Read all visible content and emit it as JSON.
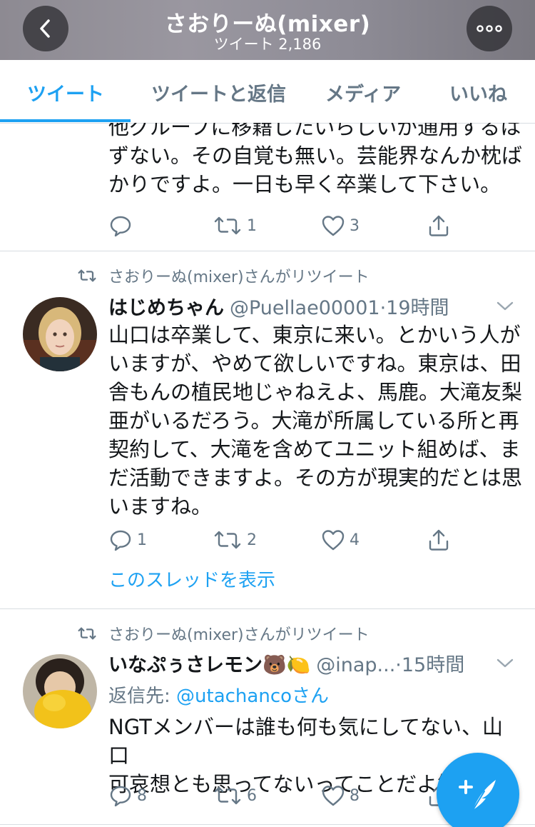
{
  "header": {
    "title": "さおりーぬ(mixer)",
    "subtitle": "ツイート 2,186",
    "back_icon": "chevron-left-icon",
    "more_icon": "more-dots-icon"
  },
  "tabs": [
    {
      "label": "ツイート",
      "active": true
    },
    {
      "label": "ツイートと返信",
      "active": false
    },
    {
      "label": "メディア",
      "active": false
    },
    {
      "label": "いいね",
      "active": false
    }
  ],
  "tweets": [
    {
      "text_lines": [
        "他グループに移籍したいらしいが通用するは",
        "ずない。その自覚も無い。芸能界なんか枕ば",
        "かりですよ。一日も早く卒業して下さい。"
      ],
      "reply_count": "",
      "retweet_count": "1",
      "like_count": "3"
    },
    {
      "retweet_label": "さおりーぬ(mixer)さんがリツイート",
      "name": "はじめちゃん",
      "handle": "@Puellae00001·19時間",
      "text_lines": [
        "山口は卒業して、東京に来い。とかいう人が",
        "いますが、やめて欲しいですね。東京は、田",
        "舎もんの植民地じゃねえよ、馬鹿。大滝友梨",
        "亜がいるだろう。大滝が所属している所と再",
        "契約して、大滝を含めてユニット組めば、ま",
        "だ活動できますよ。その方が現実的だとは思",
        "いますね。"
      ],
      "reply_count": "1",
      "retweet_count": "2",
      "like_count": "4",
      "show_thread": "このスレッドを表示"
    },
    {
      "retweet_label": "さおりーぬ(mixer)さんがリツイート",
      "name": "いなぷぅさレモン🐻🍋",
      "handle": "@inap...·15時間",
      "reply_prefix": "返信先: ",
      "reply_to": "@utachancoさん",
      "text_lines": [
        "NGTメンバーは誰も何も気にしてない、山口",
        "可哀想とも思ってないってことだよ笑"
      ],
      "reply_count": "8",
      "retweet_count": "6",
      "like_count": "8"
    }
  ],
  "compose_icon": "compose-feather-icon",
  "colors": {
    "accent": "#1da1f2",
    "secondary_text": "#657786",
    "primary_text": "#14171a",
    "divider": "#d8dde1"
  }
}
